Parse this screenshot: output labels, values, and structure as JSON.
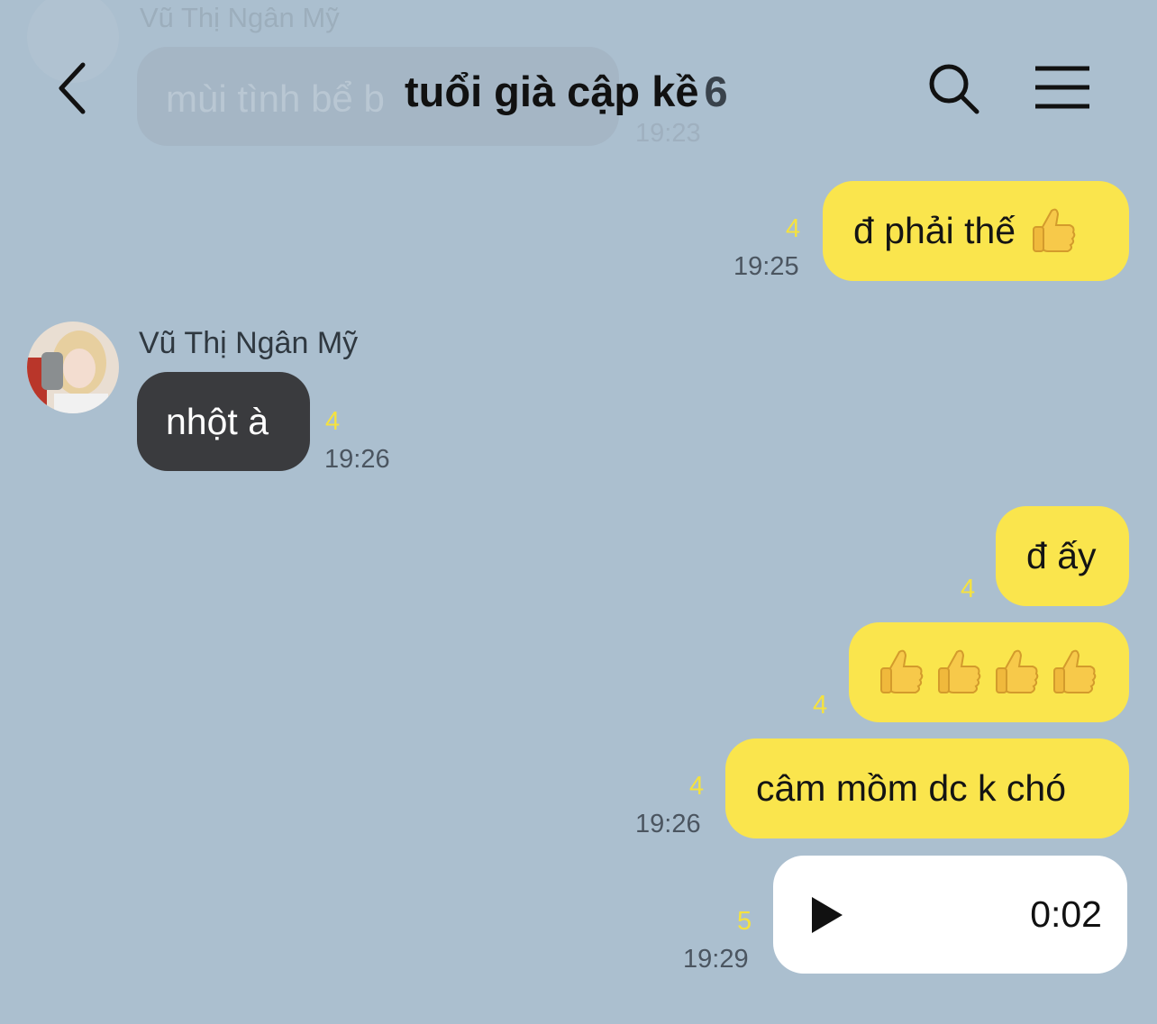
{
  "header": {
    "title": "tuổi già cập kề",
    "member_count": "6",
    "back_icon": "chevron-left-icon",
    "search_icon": "search-icon",
    "menu_icon": "hamburger-menu-icon"
  },
  "faded_message": {
    "sender": "Vũ Thị Ngân Mỹ",
    "text": "mùi tình bể b",
    "time": "19:23"
  },
  "messages": [
    {
      "side": "out",
      "text": "đ phải thế",
      "emoji": [
        "thumbs-up-icon"
      ],
      "unread": "4",
      "time": "19:25"
    },
    {
      "side": "in",
      "sender": "Vũ Thị Ngân Mỹ",
      "text": "nhột à",
      "unread": "4",
      "time": "19:26"
    },
    {
      "side": "out",
      "text": "đ ấy",
      "unread": "4"
    },
    {
      "side": "out",
      "text": "",
      "emoji": [
        "thumbs-up-icon",
        "thumbs-up-icon",
        "thumbs-up-icon",
        "thumbs-up-icon"
      ],
      "unread": "4"
    },
    {
      "side": "out",
      "text": "câm mồm dc k chó",
      "unread": "4",
      "time": "19:26"
    },
    {
      "side": "out",
      "type": "voice",
      "duration": "0:02",
      "unread": "5",
      "time": "19:29"
    }
  ],
  "colors": {
    "background": "#abbfcf",
    "outgoing_bubble": "#fae54d",
    "incoming_bubble": "#3a3b3e",
    "unread_count": "#f5e23f"
  }
}
